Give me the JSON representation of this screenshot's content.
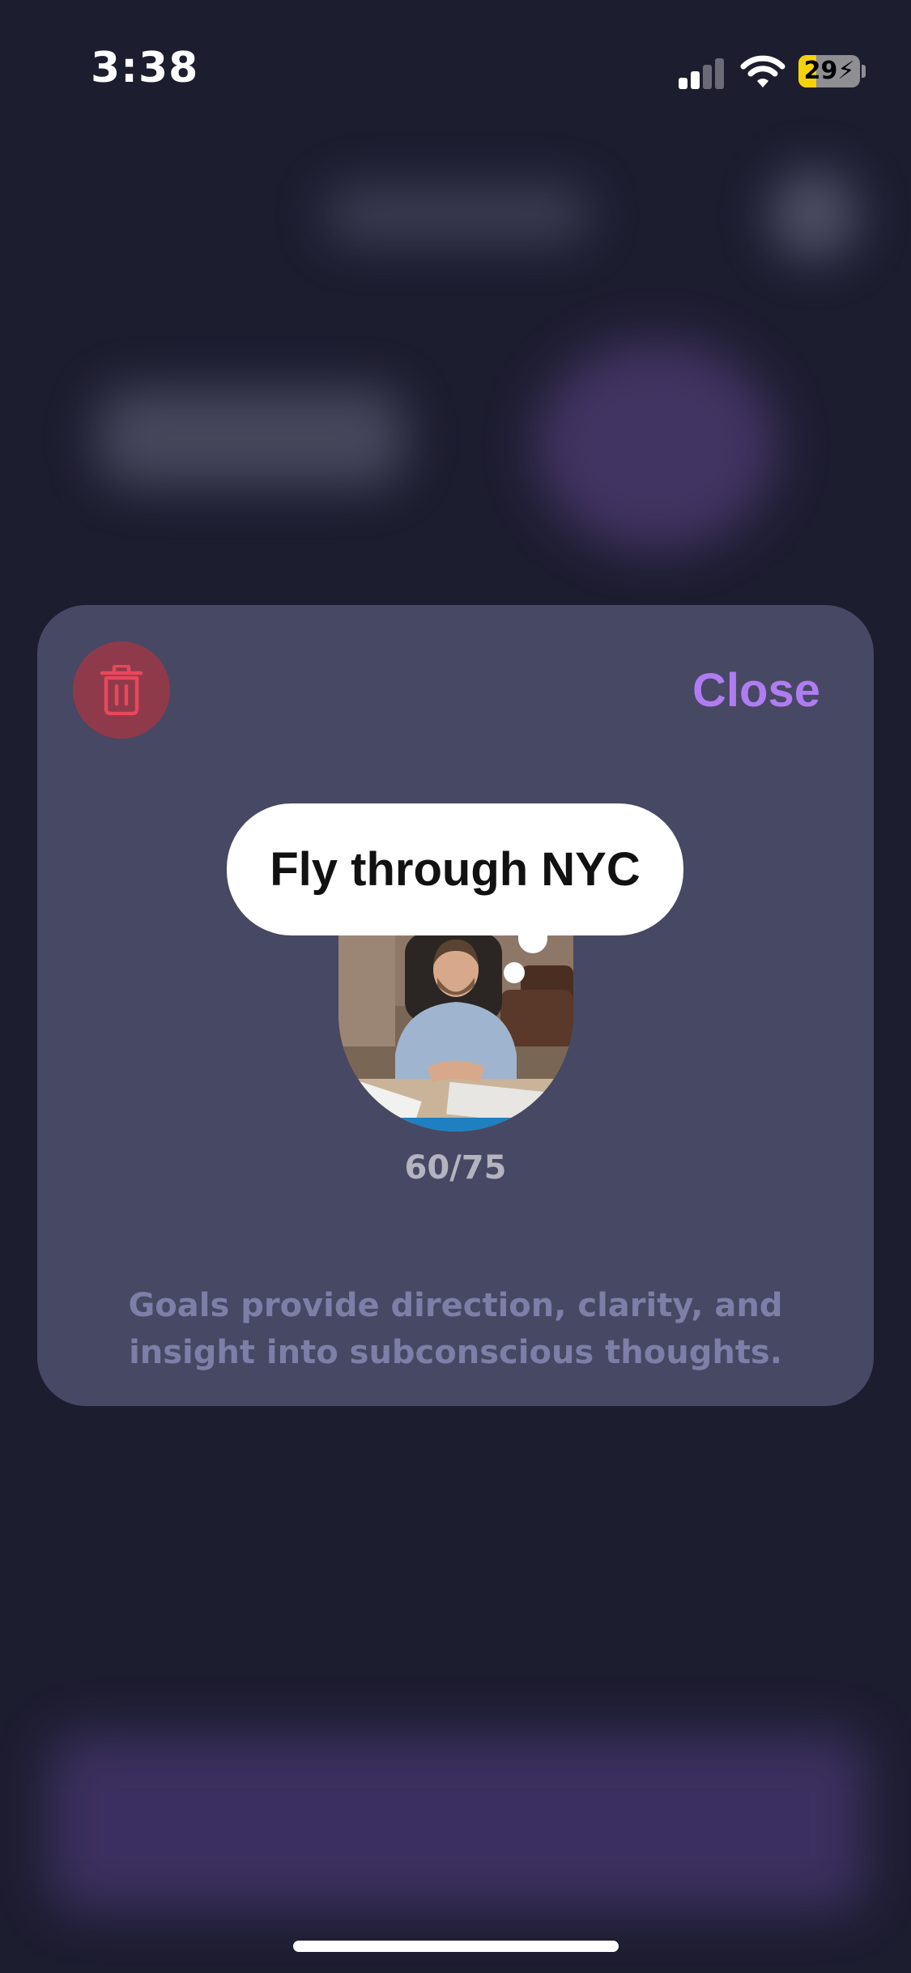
{
  "status_bar": {
    "time": "3:38",
    "battery_level": "29",
    "battery_fraction": 0.29,
    "signal_bars_active": 2,
    "signal_bars_total": 4,
    "icons": [
      "cellular-signal-icon",
      "wifi-icon",
      "battery-charging-icon"
    ]
  },
  "goal_card": {
    "delete_icon": "trash-icon",
    "close_label": "Close",
    "goal_title": "Fly through NYC",
    "progress_text": "60/75",
    "progress_current": 60,
    "progress_total": 75,
    "caption": "Goals provide direction, clarity, and insight into subconscious thoughts."
  },
  "colors": {
    "background": "#1d1d30",
    "card": "#474863",
    "accent": "#b07cf2",
    "delete_bg": "#8f3a4a",
    "delete_icon": "#e8475d",
    "battery_fill": "#f5d20a"
  }
}
